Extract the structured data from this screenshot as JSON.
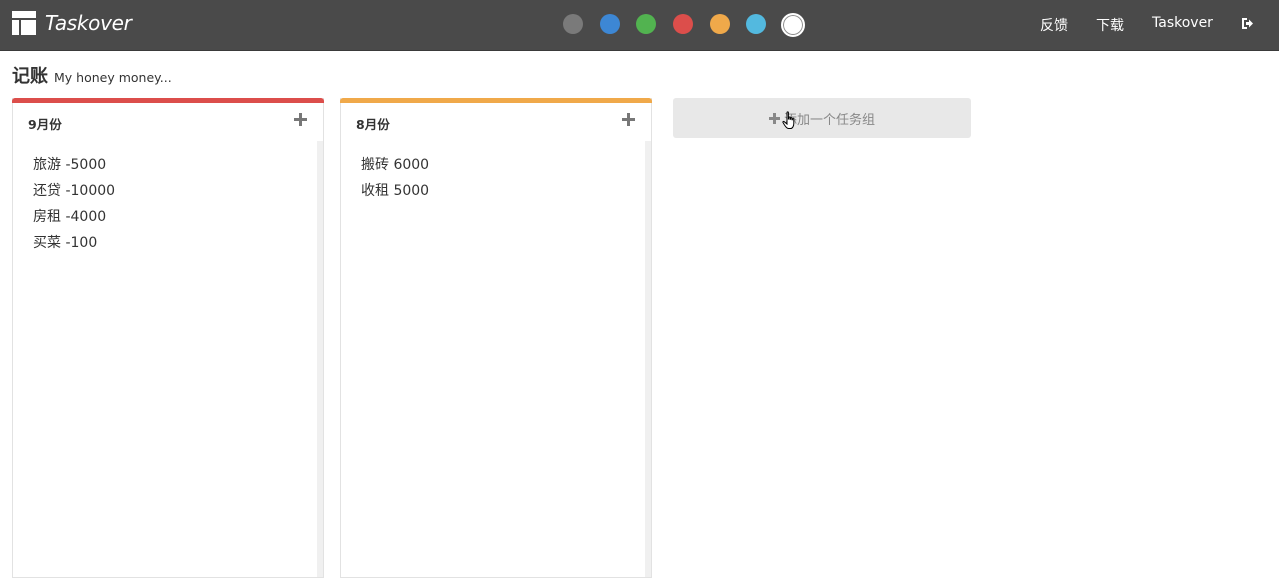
{
  "header": {
    "brand": "Taskover",
    "brand_icon": "layout-icon",
    "swatches": [
      {
        "name": "gray",
        "color": "#7a7a7a",
        "active": false
      },
      {
        "name": "blue",
        "color": "#3d87d4",
        "active": false
      },
      {
        "name": "green",
        "color": "#52b350",
        "active": false
      },
      {
        "name": "red",
        "color": "#dc4e4b",
        "active": false
      },
      {
        "name": "orange",
        "color": "#f0a94a",
        "active": false
      },
      {
        "name": "cyan",
        "color": "#53b9df",
        "active": false
      },
      {
        "name": "white",
        "color": "#ffffff",
        "active": true
      }
    ],
    "nav": {
      "feedback": "反馈",
      "download": "下载",
      "user": "Taskover",
      "logout_icon": "sign-out-icon"
    }
  },
  "page": {
    "title": "记账",
    "subtitle": "My honey money..."
  },
  "columns": [
    {
      "title": "9月份",
      "color": "#dc4e4b",
      "tasks": [
        "旅游 -5000",
        "还贷 -10000",
        "房租 -4000",
        "买菜 -100"
      ]
    },
    {
      "title": "8月份",
      "color": "#f0a94a",
      "tasks": [
        "搬砖 6000",
        "收租 5000"
      ]
    }
  ],
  "add_group": {
    "label": "添加一个任务组",
    "icon": "plus-icon"
  }
}
